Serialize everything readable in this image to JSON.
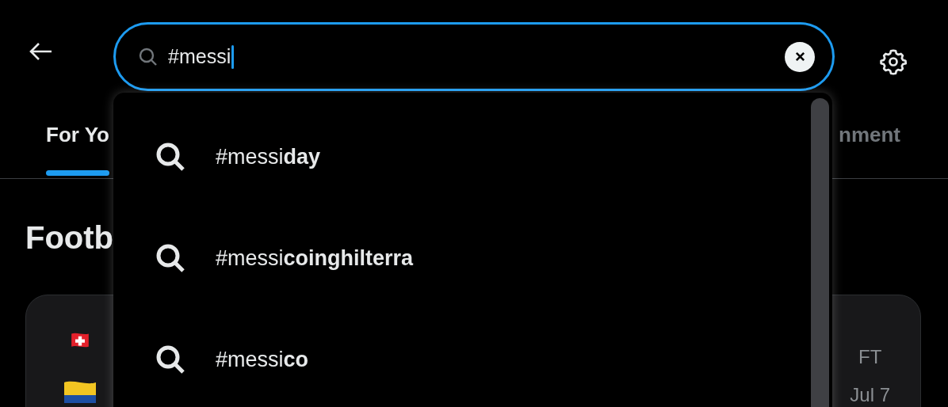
{
  "search": {
    "value": "#messi"
  },
  "tabs": [
    {
      "label": "For Yo",
      "selected": true
    },
    {
      "label": "nment",
      "selected": false
    }
  ],
  "section": {
    "title": "Footb"
  },
  "match_card": {
    "status": "FT",
    "date": "Jul 7"
  },
  "suggestions": [
    {
      "text": "#messi**day**"
    },
    {
      "text": "#messi**coinghilterra**"
    },
    {
      "text": "#messi**co**"
    }
  ]
}
